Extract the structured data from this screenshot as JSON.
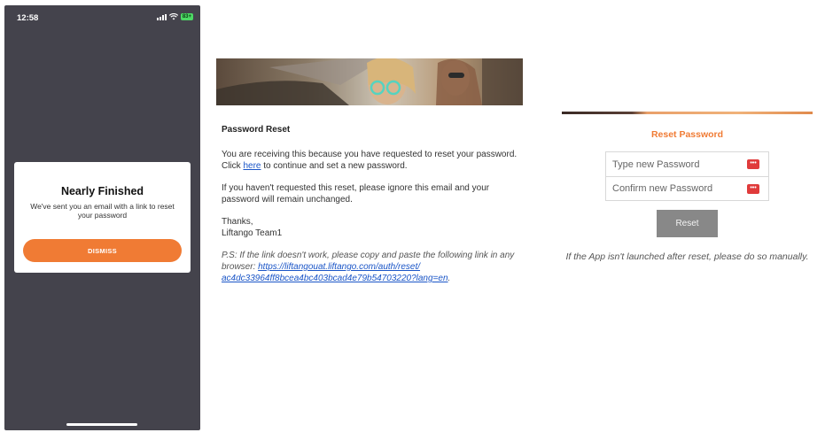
{
  "phone": {
    "status": {
      "time": "12:58",
      "battery": "83+"
    },
    "modal": {
      "title": "Nearly Finished",
      "message": "We've sent you an email with a link to reset your password",
      "dismiss_label": "DISMISS"
    }
  },
  "email": {
    "heading": "Password Reset",
    "para1_before_link": "You are receiving this because you have requested to reset your password. Click ",
    "para1_link": "here",
    "para1_after_link": " to continue and set a new password.",
    "para2": "If you haven't requested this reset, please ignore this email and your password will remain unchanged.",
    "thanks": "Thanks,",
    "signature": "Liftango Team1",
    "ps_before_link": "P.S: If the link doesn't work, please copy and paste the following link in any browser: ",
    "ps_link": "https://liftangouat.liftango.com/auth/reset/ ac4dc33964ff8bcea4bc403bcad4e79b54703220?lang=en",
    "ps_after_link": "."
  },
  "reset": {
    "title": "Reset Password",
    "new_password_placeholder": "Type new Password",
    "confirm_password_placeholder": "Confirm new Password",
    "reset_label": "Reset",
    "note": "If the App isn't launched after reset, please do so manually."
  },
  "colors": {
    "accent": "#f07b34",
    "phone_bg": "#44434c",
    "link": "#1a55c7",
    "button_gray": "#888888"
  }
}
